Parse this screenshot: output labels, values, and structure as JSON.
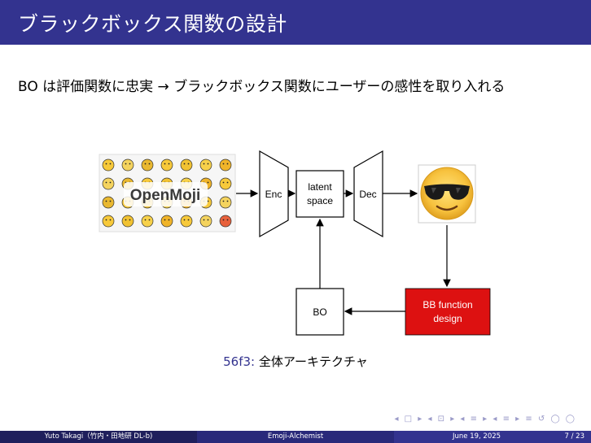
{
  "slide": {
    "title": "ブラックボックス関数の設計",
    "subtitle": "BO は評価関数に忠実 → ブラックボックス関数にユーザーの感性を取り入れる"
  },
  "diagram": {
    "openmoji_logo": "OpenMoji",
    "enc_label": "Enc",
    "latent_label_line1": "latent",
    "latent_label_line2": "space",
    "dec_label": "Dec",
    "bo_label": "BO",
    "bb_label_line1": "BB function",
    "bb_label_line2": "design",
    "bb_color": "#dd1111",
    "output_emoji": "smiling-face-with-sunglasses"
  },
  "caption": {
    "fig_number": "56f3:",
    "text": "全体アーキテクチャ"
  },
  "nav": {
    "symbols": "◂ □ ▸ ◂ ⊡ ▸ ◂ ≡ ▸ ◂ ≡ ▸   ≡   ↺ ◯ ◯"
  },
  "footer": {
    "author": "Yuto Takagi（竹内・田地研 DL-b)",
    "short_title": "Emoji-Alchemist",
    "date": "June 19, 2025",
    "page": "7 / 23"
  },
  "colors": {
    "title_bar": "#33338f",
    "footer_dark": "#1f1f5c",
    "footer_mid": "#29297a"
  }
}
